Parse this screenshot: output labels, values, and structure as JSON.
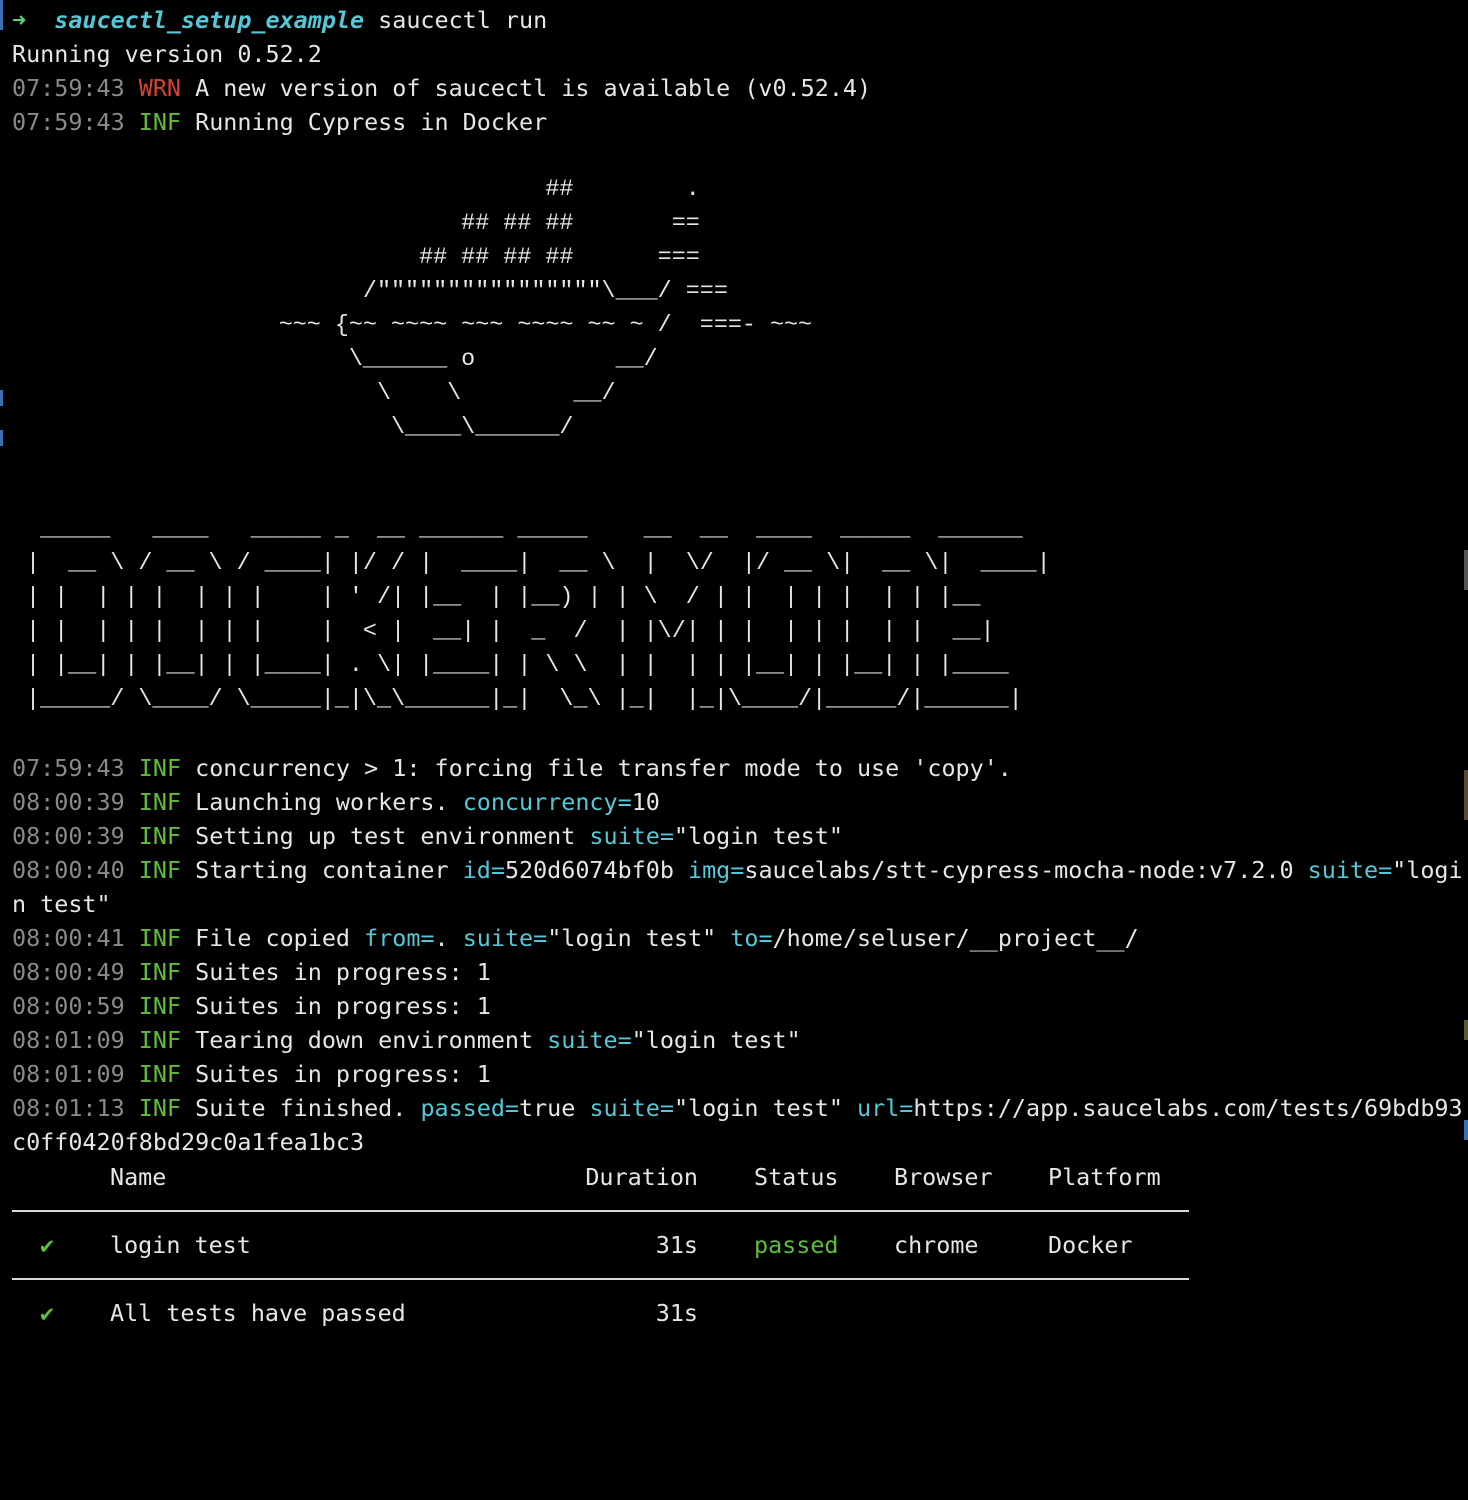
{
  "prompt": {
    "arrow": "➜",
    "directory": "saucectl_setup_example",
    "command": "saucectl run"
  },
  "header_lines": [
    {
      "text": "Running version 0.52.2"
    },
    {
      "ts": "07:59:43",
      "level": "WRN",
      "msg": "A new version of saucectl is available (v0.52.4)"
    },
    {
      "ts": "07:59:43",
      "level": "INF",
      "msg": "Running Cypress in Docker"
    }
  ],
  "whale_art": "                                      ##        .\n                                ## ## ##       ==\n                             ## ## ## ##      ===\n                         /\"\"\"\"\"\"\"\"\"\"\"\"\"\"\"\"\\___/ ===\n                   ~~~ {~~ ~~~~ ~~~ ~~~~ ~~ ~ /  ===- ~~~\n                        \\______ o          __/\n                          \\    \\        __/\n                           \\____\\______/",
  "banner_art": "  _____   ____   _____ _  __ ______ _____    __  __  ____  _____  ______\n |  __ \\ / __ \\ / ____| |/ / |  ____|  __ \\  |  \\/  |/ __ \\|  __ \\|  ____|\n | |  | | |  | | |    | ' /| |__  | |__) | | \\  / | |  | | |  | | |__\n | |  | | |  | | |    |  < |  __| |  _  /  | |\\/| | |  | | |  | |  __|\n | |__| | |__| | |____| . \\| |____| | \\ \\  | |  | | |__| | |__| | |____\n |_____/ \\____/ \\_____|_|\\_\\______|_|  \\_\\ |_|  |_|\\____/|_____/|______|",
  "log_lines": [
    {
      "ts": "07:59:43",
      "level": "INF",
      "parts": [
        {
          "t": "concurrency > 1: forcing file transfer mode to use 'copy'."
        }
      ]
    },
    {
      "ts": "08:00:39",
      "level": "INF",
      "parts": [
        {
          "t": "Launching workers. "
        },
        {
          "k": "concurrency="
        },
        {
          "t": "10"
        }
      ]
    },
    {
      "ts": "08:00:39",
      "level": "INF",
      "parts": [
        {
          "t": "Setting up test environment "
        },
        {
          "k": "suite="
        },
        {
          "t": "\"login test\""
        }
      ]
    },
    {
      "ts": "08:00:40",
      "level": "INF",
      "parts": [
        {
          "t": "Starting container "
        },
        {
          "k": "id="
        },
        {
          "t": "520d6074bf0b "
        },
        {
          "k": "img="
        },
        {
          "t": "saucelabs/stt-cypress-mocha-node:v7.2.0 "
        },
        {
          "k": "suite="
        },
        {
          "t": "\"logi"
        }
      ]
    },
    {
      "wrap": "n test\""
    },
    {
      "ts": "08:00:41",
      "level": "INF",
      "parts": [
        {
          "t": "File copied "
        },
        {
          "k": "from="
        },
        {
          "t": ". "
        },
        {
          "k": "suite="
        },
        {
          "t": "\"login test\" "
        },
        {
          "k": "to="
        },
        {
          "t": "/home/seluser/__project__/"
        }
      ]
    },
    {
      "ts": "08:00:49",
      "level": "INF",
      "parts": [
        {
          "t": "Suites in progress: 1"
        }
      ]
    },
    {
      "ts": "08:00:59",
      "level": "INF",
      "parts": [
        {
          "t": "Suites in progress: 1"
        }
      ]
    },
    {
      "ts": "08:01:09",
      "level": "INF",
      "parts": [
        {
          "t": "Tearing down environment "
        },
        {
          "k": "suite="
        },
        {
          "t": "\"login test\""
        }
      ]
    },
    {
      "ts": "08:01:09",
      "level": "INF",
      "parts": [
        {
          "t": "Suites in progress: 1"
        }
      ]
    },
    {
      "ts": "08:01:13",
      "level": "INF",
      "parts": [
        {
          "t": "Suite finished. "
        },
        {
          "k": "passed="
        },
        {
          "t": "true "
        },
        {
          "k": "suite="
        },
        {
          "t": "\"login test\" "
        },
        {
          "k": "url="
        },
        {
          "t": "https://app.saucelabs.com/tests/69bdb93"
        }
      ]
    },
    {
      "wrap": "c0ff0420f8bd29c0a1fea1bc3"
    }
  ],
  "results": {
    "headers": {
      "name": "Name",
      "duration": "Duration",
      "status": "Status",
      "browser": "Browser",
      "platform": "Platform"
    },
    "rows": [
      {
        "check": "✔",
        "name": "login test",
        "duration": "31s",
        "status": "passed",
        "browser": "chrome",
        "platform": "Docker"
      }
    ],
    "summary": {
      "check": "✔",
      "text": "All tests have passed",
      "duration": "31s"
    }
  },
  "colors": {
    "background": "#000000",
    "timestamp": "#8a8a8a",
    "info": "#5fbf3a",
    "warn": "#d8402f",
    "key": "#55c8d8",
    "text": "#e6e6e6"
  }
}
